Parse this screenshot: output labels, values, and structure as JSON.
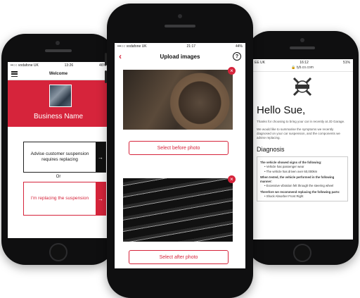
{
  "left_phone": {
    "status": {
      "carrier": "••○○ vodafone UK",
      "time": "13:26",
      "battery": "46%"
    },
    "nav": {
      "title": "Welcome"
    },
    "banner": {
      "business_name": "Business Name"
    },
    "advise_button": {
      "label": "Advise customer suspension requires replacing",
      "arrow": "→"
    },
    "or_label": "Or",
    "replace_button": {
      "label": "I'm replacing the suspension",
      "arrow": "→"
    }
  },
  "center_phone": {
    "status": {
      "carrier": "•••○○ vodafone UK",
      "time": "21:17",
      "battery": "44%"
    },
    "header": {
      "title": "Upload images",
      "back": "‹",
      "help": "?"
    },
    "before_card": {
      "button_label": "Select before photo",
      "remove": "×"
    },
    "after_card": {
      "button_label": "Select after photo",
      "remove": "×"
    }
  },
  "right_phone": {
    "status": {
      "carrier": "EE UK",
      "time": "16:12",
      "battery": "51%"
    },
    "url": "🔒 tyb.co.com",
    "greeting": "Hello Sue,",
    "intro_1": "Thanks for choosing to bring your car in recently at JD Garage.",
    "intro_2": "We would like to summarise the symptoms we recently diagnosed on your car suspension, and the components we advise replacing.",
    "diagnosis_heading": "Diagnosis",
    "diagnosis": {
      "signs_heading": "The vehicle showed signs of the following:",
      "signs": [
        "Vehicle has passenger wear",
        "The vehicle has driven over 60,000km"
      ],
      "test_heading": "When tested, the vehicle performed in the following manner:",
      "test_items": [
        "Excessive vibration felt through the steering wheel"
      ],
      "recommend_heading": "Therefore we recommend replacing the following parts:",
      "recommend_items": [
        "Shock Absorber Front Right"
      ]
    }
  },
  "colors": {
    "brand_red": "#d6243b",
    "phone_body": "#0f0f10"
  }
}
